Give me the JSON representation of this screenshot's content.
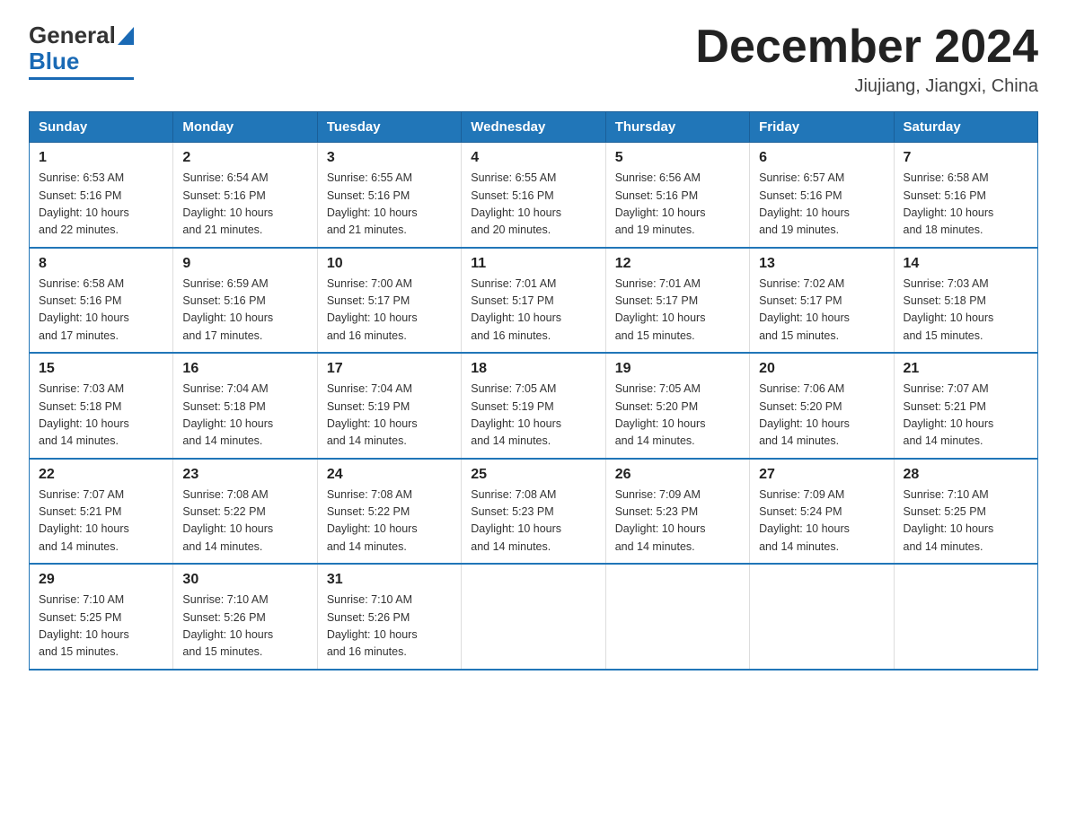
{
  "logo": {
    "general": "General",
    "blue": "Blue"
  },
  "header": {
    "month": "December 2024",
    "location": "Jiujiang, Jiangxi, China"
  },
  "weekdays": [
    "Sunday",
    "Monday",
    "Tuesday",
    "Wednesday",
    "Thursday",
    "Friday",
    "Saturday"
  ],
  "weeks": [
    [
      {
        "day": "1",
        "sunrise": "6:53 AM",
        "sunset": "5:16 PM",
        "daylight": "10 hours and 22 minutes."
      },
      {
        "day": "2",
        "sunrise": "6:54 AM",
        "sunset": "5:16 PM",
        "daylight": "10 hours and 21 minutes."
      },
      {
        "day": "3",
        "sunrise": "6:55 AM",
        "sunset": "5:16 PM",
        "daylight": "10 hours and 21 minutes."
      },
      {
        "day": "4",
        "sunrise": "6:55 AM",
        "sunset": "5:16 PM",
        "daylight": "10 hours and 20 minutes."
      },
      {
        "day": "5",
        "sunrise": "6:56 AM",
        "sunset": "5:16 PM",
        "daylight": "10 hours and 19 minutes."
      },
      {
        "day": "6",
        "sunrise": "6:57 AM",
        "sunset": "5:16 PM",
        "daylight": "10 hours and 19 minutes."
      },
      {
        "day": "7",
        "sunrise": "6:58 AM",
        "sunset": "5:16 PM",
        "daylight": "10 hours and 18 minutes."
      }
    ],
    [
      {
        "day": "8",
        "sunrise": "6:58 AM",
        "sunset": "5:16 PM",
        "daylight": "10 hours and 17 minutes."
      },
      {
        "day": "9",
        "sunrise": "6:59 AM",
        "sunset": "5:16 PM",
        "daylight": "10 hours and 17 minutes."
      },
      {
        "day": "10",
        "sunrise": "7:00 AM",
        "sunset": "5:17 PM",
        "daylight": "10 hours and 16 minutes."
      },
      {
        "day": "11",
        "sunrise": "7:01 AM",
        "sunset": "5:17 PM",
        "daylight": "10 hours and 16 minutes."
      },
      {
        "day": "12",
        "sunrise": "7:01 AM",
        "sunset": "5:17 PM",
        "daylight": "10 hours and 15 minutes."
      },
      {
        "day": "13",
        "sunrise": "7:02 AM",
        "sunset": "5:17 PM",
        "daylight": "10 hours and 15 minutes."
      },
      {
        "day": "14",
        "sunrise": "7:03 AM",
        "sunset": "5:18 PM",
        "daylight": "10 hours and 15 minutes."
      }
    ],
    [
      {
        "day": "15",
        "sunrise": "7:03 AM",
        "sunset": "5:18 PM",
        "daylight": "10 hours and 14 minutes."
      },
      {
        "day": "16",
        "sunrise": "7:04 AM",
        "sunset": "5:18 PM",
        "daylight": "10 hours and 14 minutes."
      },
      {
        "day": "17",
        "sunrise": "7:04 AM",
        "sunset": "5:19 PM",
        "daylight": "10 hours and 14 minutes."
      },
      {
        "day": "18",
        "sunrise": "7:05 AM",
        "sunset": "5:19 PM",
        "daylight": "10 hours and 14 minutes."
      },
      {
        "day": "19",
        "sunrise": "7:05 AM",
        "sunset": "5:20 PM",
        "daylight": "10 hours and 14 minutes."
      },
      {
        "day": "20",
        "sunrise": "7:06 AM",
        "sunset": "5:20 PM",
        "daylight": "10 hours and 14 minutes."
      },
      {
        "day": "21",
        "sunrise": "7:07 AM",
        "sunset": "5:21 PM",
        "daylight": "10 hours and 14 minutes."
      }
    ],
    [
      {
        "day": "22",
        "sunrise": "7:07 AM",
        "sunset": "5:21 PM",
        "daylight": "10 hours and 14 minutes."
      },
      {
        "day": "23",
        "sunrise": "7:08 AM",
        "sunset": "5:22 PM",
        "daylight": "10 hours and 14 minutes."
      },
      {
        "day": "24",
        "sunrise": "7:08 AM",
        "sunset": "5:22 PM",
        "daylight": "10 hours and 14 minutes."
      },
      {
        "day": "25",
        "sunrise": "7:08 AM",
        "sunset": "5:23 PM",
        "daylight": "10 hours and 14 minutes."
      },
      {
        "day": "26",
        "sunrise": "7:09 AM",
        "sunset": "5:23 PM",
        "daylight": "10 hours and 14 minutes."
      },
      {
        "day": "27",
        "sunrise": "7:09 AM",
        "sunset": "5:24 PM",
        "daylight": "10 hours and 14 minutes."
      },
      {
        "day": "28",
        "sunrise": "7:10 AM",
        "sunset": "5:25 PM",
        "daylight": "10 hours and 14 minutes."
      }
    ],
    [
      {
        "day": "29",
        "sunrise": "7:10 AM",
        "sunset": "5:25 PM",
        "daylight": "10 hours and 15 minutes."
      },
      {
        "day": "30",
        "sunrise": "7:10 AM",
        "sunset": "5:26 PM",
        "daylight": "10 hours and 15 minutes."
      },
      {
        "day": "31",
        "sunrise": "7:10 AM",
        "sunset": "5:26 PM",
        "daylight": "10 hours and 16 minutes."
      },
      null,
      null,
      null,
      null
    ]
  ],
  "labels": {
    "sunrise": "Sunrise:",
    "sunset": "Sunset:",
    "daylight": "Daylight:"
  }
}
